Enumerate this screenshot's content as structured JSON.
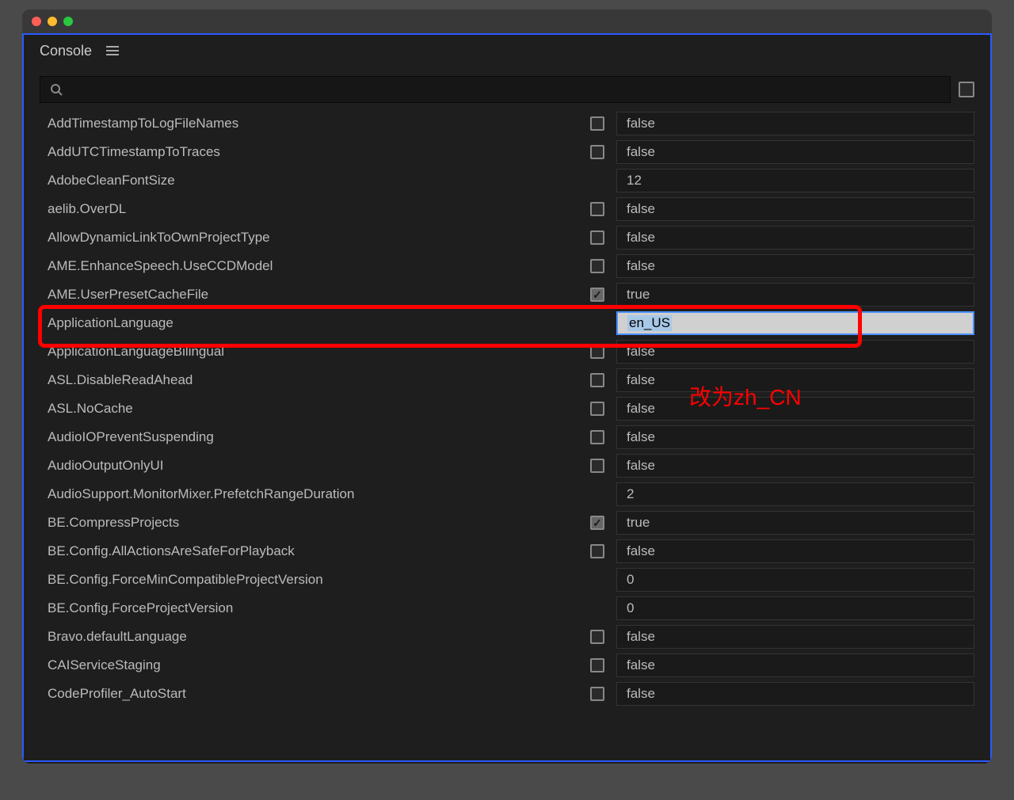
{
  "panel": {
    "title": "Console"
  },
  "search": {
    "placeholder": ""
  },
  "annotation": {
    "text": "改为zh_CN"
  },
  "settings": [
    {
      "name": "AddTimestampToLogFileNames",
      "hasCheckbox": true,
      "checked": false,
      "value": "false",
      "editing": false
    },
    {
      "name": "AddUTCTimestampToTraces",
      "hasCheckbox": true,
      "checked": false,
      "value": "false",
      "editing": false
    },
    {
      "name": "AdobeCleanFontSize",
      "hasCheckbox": false,
      "checked": false,
      "value": "12",
      "editing": false
    },
    {
      "name": "aelib.OverDL",
      "hasCheckbox": true,
      "checked": false,
      "value": "false",
      "editing": false
    },
    {
      "name": "AllowDynamicLinkToOwnProjectType",
      "hasCheckbox": true,
      "checked": false,
      "value": "false",
      "editing": false
    },
    {
      "name": "AME.EnhanceSpeech.UseCCDModel",
      "hasCheckbox": true,
      "checked": false,
      "value": "false",
      "editing": false
    },
    {
      "name": "AME.UserPresetCacheFile",
      "hasCheckbox": true,
      "checked": true,
      "value": "true",
      "editing": false
    },
    {
      "name": "ApplicationLanguage",
      "hasCheckbox": false,
      "checked": false,
      "value": "en_US",
      "editing": true
    },
    {
      "name": "ApplicationLanguageBilingual",
      "hasCheckbox": true,
      "checked": false,
      "value": "false",
      "editing": false
    },
    {
      "name": "ASL.DisableReadAhead",
      "hasCheckbox": true,
      "checked": false,
      "value": "false",
      "editing": false
    },
    {
      "name": "ASL.NoCache",
      "hasCheckbox": true,
      "checked": false,
      "value": "false",
      "editing": false
    },
    {
      "name": "AudioIOPreventSuspending",
      "hasCheckbox": true,
      "checked": false,
      "value": "false",
      "editing": false
    },
    {
      "name": "AudioOutputOnlyUI",
      "hasCheckbox": true,
      "checked": false,
      "value": "false",
      "editing": false
    },
    {
      "name": "AudioSupport.MonitorMixer.PrefetchRangeDuration",
      "hasCheckbox": false,
      "checked": false,
      "value": "2",
      "editing": false
    },
    {
      "name": "BE.CompressProjects",
      "hasCheckbox": true,
      "checked": true,
      "value": "true",
      "editing": false
    },
    {
      "name": "BE.Config.AllActionsAreSafeForPlayback",
      "hasCheckbox": true,
      "checked": false,
      "value": "false",
      "editing": false
    },
    {
      "name": "BE.Config.ForceMinCompatibleProjectVersion",
      "hasCheckbox": false,
      "checked": false,
      "value": "0",
      "editing": false
    },
    {
      "name": "BE.Config.ForceProjectVersion",
      "hasCheckbox": false,
      "checked": false,
      "value": "0",
      "editing": false
    },
    {
      "name": "Bravo.defaultLanguage",
      "hasCheckbox": true,
      "checked": false,
      "value": "false",
      "editing": false
    },
    {
      "name": "CAIServiceStaging",
      "hasCheckbox": true,
      "checked": false,
      "value": "false",
      "editing": false
    },
    {
      "name": "CodeProfiler_AutoStart",
      "hasCheckbox": true,
      "checked": false,
      "value": "false",
      "editing": false
    }
  ]
}
